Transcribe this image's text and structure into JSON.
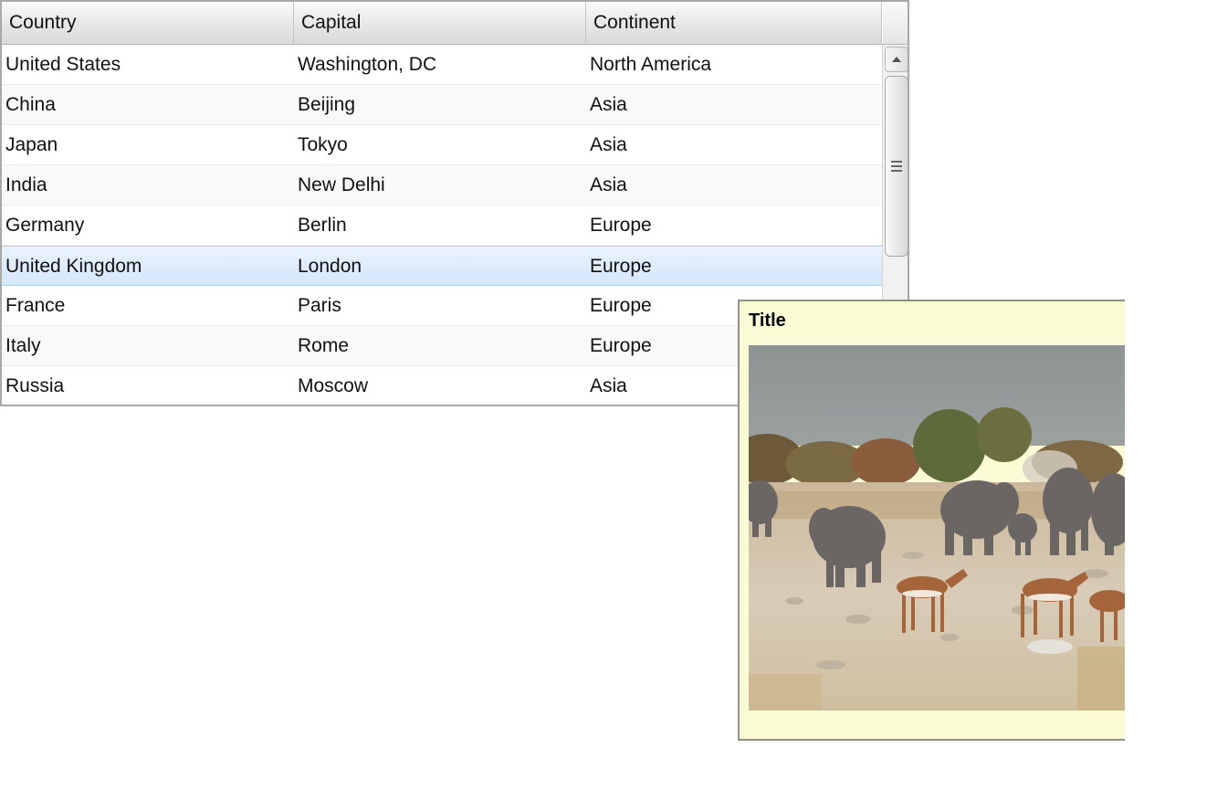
{
  "table": {
    "columns": [
      "Country",
      "Capital",
      "Continent"
    ],
    "rows": [
      {
        "country": "United States",
        "capital": "Washington, DC",
        "continent": "North America"
      },
      {
        "country": "China",
        "capital": "Beijing",
        "continent": "Asia"
      },
      {
        "country": "Japan",
        "capital": "Tokyo",
        "continent": "Asia"
      },
      {
        "country": "India",
        "capital": "New Delhi",
        "continent": "Asia"
      },
      {
        "country": "Germany",
        "capital": "Berlin",
        "continent": "Europe"
      },
      {
        "country": "United Kingdom",
        "capital": "London",
        "continent": "Europe"
      },
      {
        "country": "France",
        "capital": "Paris",
        "continent": "Europe"
      },
      {
        "country": "Italy",
        "capital": "Rome",
        "continent": "Europe"
      },
      {
        "country": "Russia",
        "capital": "Moscow",
        "continent": "Asia"
      }
    ],
    "selected_row": 5
  },
  "popup": {
    "title": "Title",
    "image_subject": "elephants-and-impalas-photo"
  },
  "colors": {
    "selection": "#d9eafc",
    "popup_background": "#fbfbd5",
    "grid_border": "#a8a8a8"
  }
}
